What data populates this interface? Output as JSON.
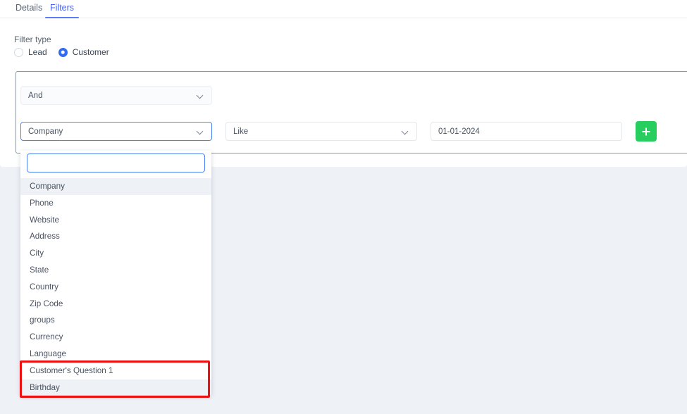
{
  "tabs": [
    {
      "label": "Details",
      "active": false
    },
    {
      "label": "Filters",
      "active": true
    }
  ],
  "filter_type": {
    "label": "Filter type",
    "options": [
      {
        "label": "Lead",
        "selected": false
      },
      {
        "label": "Customer",
        "selected": true
      }
    ]
  },
  "filter_row": {
    "conjunction": {
      "value": "And",
      "icon": "chevron-down-icon"
    },
    "field": {
      "value": "Company",
      "icon": "chevron-down-icon"
    },
    "operator": {
      "value": "Like",
      "icon": "chevron-down-icon"
    },
    "value_input": {
      "value": "01-01-2024",
      "placeholder": ""
    },
    "add_button": {
      "icon": "plus-icon",
      "color": "#27ce5f"
    }
  },
  "dropdown": {
    "search": {
      "value": "",
      "placeholder": ""
    },
    "items": [
      {
        "label": "Company",
        "highlighted": true
      },
      {
        "label": "Phone",
        "highlighted": false
      },
      {
        "label": "Website",
        "highlighted": false
      },
      {
        "label": "Address",
        "highlighted": false
      },
      {
        "label": "City",
        "highlighted": false
      },
      {
        "label": "State",
        "highlighted": false
      },
      {
        "label": "Country",
        "highlighted": false
      },
      {
        "label": "Zip Code",
        "highlighted": false
      },
      {
        "label": "groups",
        "highlighted": false
      },
      {
        "label": "Currency",
        "highlighted": false
      },
      {
        "label": "Language",
        "highlighted": false
      },
      {
        "label": "Customer's Question 1",
        "highlighted": false
      },
      {
        "label": "Birthday",
        "highlighted": true
      }
    ]
  },
  "annotation": {
    "color": "#ee1111",
    "shape": "rectangle"
  },
  "colors": {
    "accent_blue": "#4460f1",
    "focus_blue": "#4d82f3",
    "radio_blue": "#2f6bf5",
    "add_green": "#27ce5f",
    "page_bg": "#eef1f6",
    "highlight_row": "#eef1f6"
  }
}
